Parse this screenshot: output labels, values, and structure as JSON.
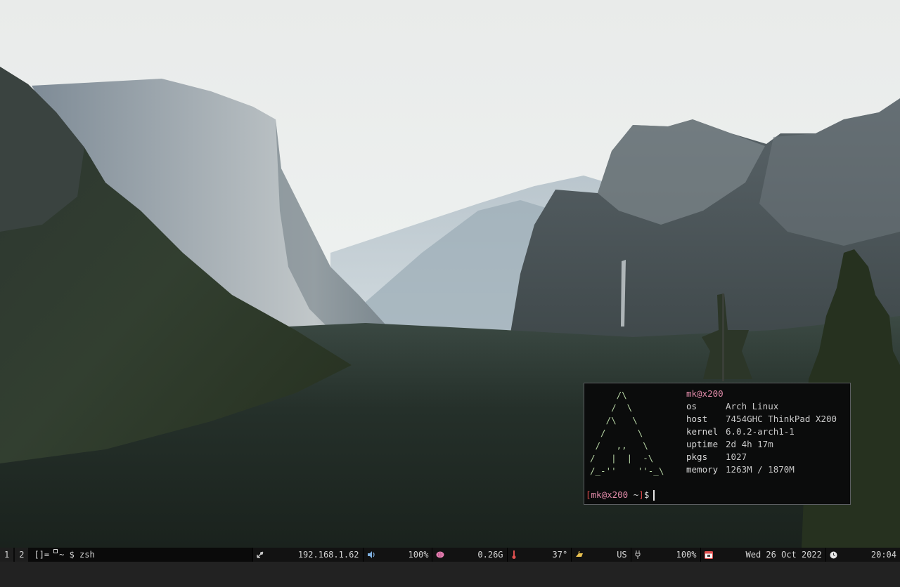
{
  "desktop": {
    "wallpaper_icon": "mountain-valley-wallpaper"
  },
  "terminal": {
    "logo_lines": [
      "     /\\",
      "    /  \\",
      "   /\\   \\",
      "  /      \\",
      " /   ,,   \\",
      "/   |  |  -\\",
      "/_-''    ''-_\\"
    ],
    "userhost": "mk@x200",
    "rows": [
      {
        "key": "os",
        "value": "Arch Linux"
      },
      {
        "key": "host",
        "value": "7454GHC ThinkPad X200"
      },
      {
        "key": "kernel",
        "value": "6.0.2-arch1-1"
      },
      {
        "key": "uptime",
        "value": "2d 4h 17m"
      },
      {
        "key": "pkgs",
        "value": "1027"
      },
      {
        "key": "memory",
        "value": "1263M / 1870M"
      }
    ],
    "prompt": {
      "open": "[",
      "user": "mk@x200",
      "dir": " ~",
      "close": "]",
      "symbol": "$"
    }
  },
  "statusbar": {
    "tags": [
      "1",
      "2"
    ],
    "layout": "[]=",
    "title": "~ $ zsh",
    "ip": "192.168.1.62",
    "volume": "100%",
    "memory": "0.26G",
    "temp": "37°",
    "keyboard": "US",
    "battery": "100%",
    "date": "Wed 26 Oct 2022",
    "time": "20:04",
    "colors": {
      "ip_icon": "#c6c6c6",
      "volume_icon": "#7fb0e0",
      "memory_icon": "#e77fb3",
      "temp_icon": "#e05050",
      "keyboard_icon": "#e8c050",
      "calendar_icon": "#e05050"
    }
  }
}
